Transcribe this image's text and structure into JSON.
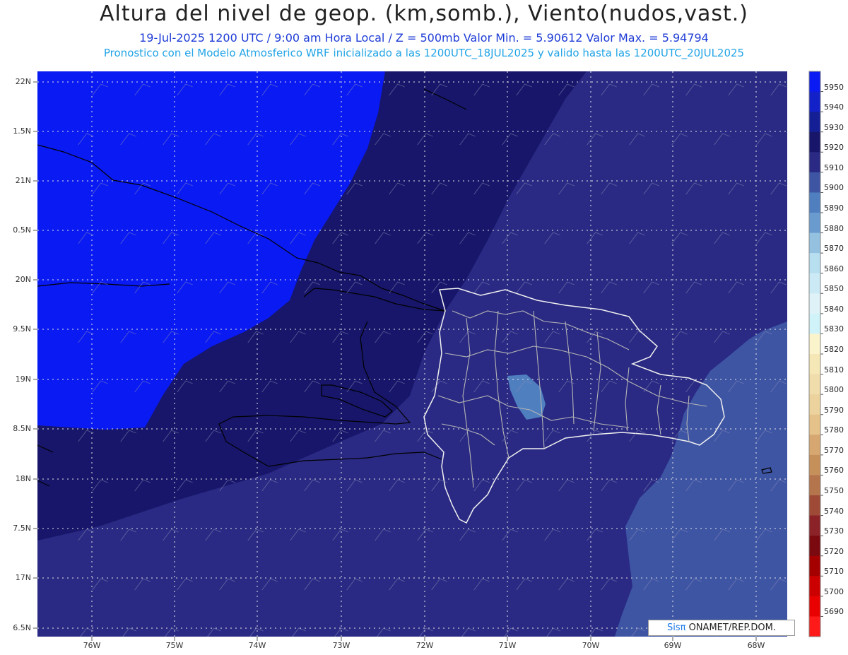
{
  "header": {
    "title": "Altura del nivel de geop. (km,somb.), Viento(nudos,vast.)",
    "subtitle": "19-Jul-2025   1200 UTC / 9:00 am Hora Local / Z = 500mb    Valor Min. = 5.90612  Valor Max. = 5.94794",
    "model_line": "Pronostico con el Modelo Atmosferico WRF inicializado a las 1200UTC_18JUL2025 y valido hasta las  1200UTC_20JUL2025"
  },
  "latitude_labels": [
    "22N",
    "1.5N",
    "21N",
    "0.5N",
    "20N",
    "9.5N",
    "19N",
    "8.5N",
    "18N",
    "7.5N",
    "17N",
    "6.5N"
  ],
  "longitude_labels": [
    "76W",
    "75W",
    "74W",
    "73W",
    "72W",
    "71W",
    "70W",
    "69W",
    "68W"
  ],
  "colorbar": {
    "levels": [
      5950,
      5940,
      5930,
      5920,
      5910,
      5900,
      5890,
      5880,
      5870,
      5860,
      5850,
      5840,
      5830,
      5820,
      5810,
      5800,
      5790,
      5780,
      5770,
      5760,
      5750,
      5740,
      5730,
      5720,
      5710,
      5700,
      5690
    ],
    "colors": [
      "#0a1af2",
      "#1321c8",
      "#141f96",
      "#17166a",
      "#2a2a84",
      "#3e55a4",
      "#4f7fbf",
      "#6a9bcf",
      "#93c1df",
      "#b8dff0",
      "#cbeaf5",
      "#dff2f8",
      "#cff3f8",
      "#fbf3cc",
      "#f6e7b6",
      "#f1dcab",
      "#ecd39e",
      "#e4c28a",
      "#d6a770",
      "#c6905b",
      "#b4744c",
      "#9e4a37",
      "#8a2228",
      "#7a0a10",
      "#a50000",
      "#cc0000",
      "#e90000",
      "#ff1a1a"
    ]
  },
  "colors": {
    "max_region": "#0a1af2",
    "mid_region": "#17166a",
    "low_region": "#2a2a84",
    "east_region": "#3e55a4",
    "coastline": "#000000",
    "province_border": "#c8c8c8"
  },
  "credit": {
    "brand": "Sisπ",
    "text": " ONAMET/REP.DOM."
  }
}
